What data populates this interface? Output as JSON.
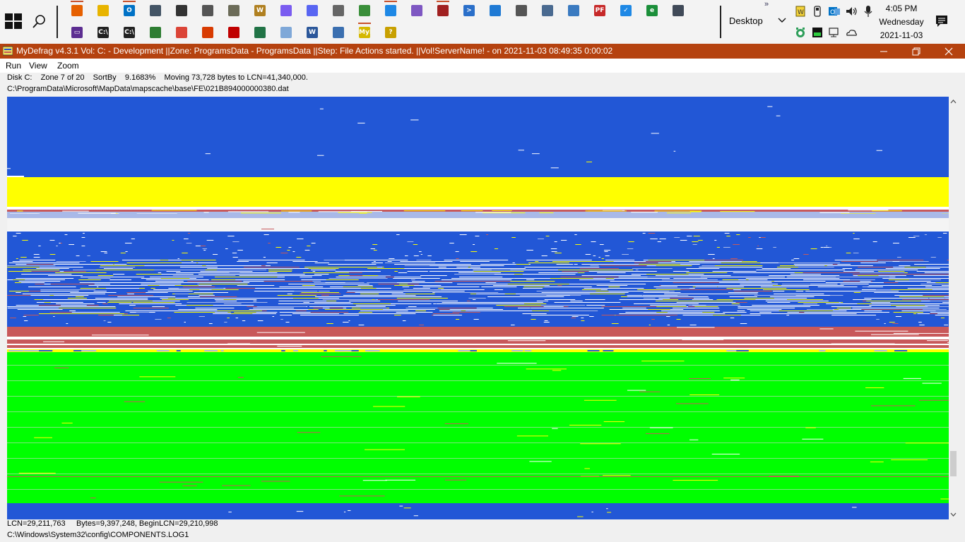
{
  "taskbar": {
    "pinned_row1": [
      {
        "name": "firefox-icon",
        "color": "#e66000",
        "glyph": "",
        "running": true
      },
      {
        "name": "file-explorer-icon",
        "color": "#e8b400",
        "glyph": "",
        "running": false
      },
      {
        "name": "outlook-icon",
        "color": "#0072c6",
        "glyph": "O",
        "running": true
      },
      {
        "name": "network-tool-icon",
        "color": "#445566",
        "glyph": "",
        "running": false
      },
      {
        "name": "camera-tool-icon",
        "color": "#333333",
        "glyph": "",
        "running": false
      },
      {
        "name": "robot-tool-icon",
        "color": "#555555",
        "glyph": "",
        "running": false
      },
      {
        "name": "gimp-icon",
        "color": "#6b6b58",
        "glyph": "",
        "running": false
      },
      {
        "name": "wordpad-icon",
        "color": "#b08020",
        "glyph": "W",
        "running": false
      },
      {
        "name": "messenger-icon",
        "color": "#7a5cf0",
        "glyph": "",
        "running": false
      },
      {
        "name": "discord-icon",
        "color": "#5865f2",
        "glyph": "",
        "running": false
      },
      {
        "name": "checklist-icon",
        "color": "#666666",
        "glyph": "",
        "running": false
      },
      {
        "name": "windows-xp-icon",
        "color": "#3a8f3a",
        "glyph": "",
        "running": false
      },
      {
        "name": "vscode-icon",
        "color": "#1e88e5",
        "glyph": "",
        "running": true
      },
      {
        "name": "visual-studio-icon",
        "color": "#7e57c2",
        "glyph": "",
        "running": false
      },
      {
        "name": "mydefrag-tool-icon",
        "color": "#a02020",
        "glyph": "",
        "running": true
      },
      {
        "name": "powershell-icon",
        "color": "#2a6fc9",
        "glyph": ">",
        "running": false
      },
      {
        "name": "calculator-grid-icon",
        "color": "#1f7ad4",
        "glyph": "",
        "running": false
      },
      {
        "name": "gear-icon",
        "color": "#555555",
        "glyph": "",
        "running": false
      },
      {
        "name": "computer-management-icon",
        "color": "#4a6a90",
        "glyph": "",
        "running": false
      },
      {
        "name": "control-panel-icon",
        "color": "#3a7ac0",
        "glyph": "",
        "running": false
      },
      {
        "name": "pdf-tool-icon",
        "color": "#c62828",
        "glyph": "PF",
        "running": false
      },
      {
        "name": "todo-check-icon",
        "color": "#1e88e5",
        "glyph": "✓",
        "running": false
      },
      {
        "name": "green-app-icon",
        "color": "#1b8f3a",
        "glyph": "e",
        "running": false
      },
      {
        "name": "remote-desktop-icon",
        "color": "#404a58",
        "glyph": "",
        "running": false
      }
    ],
    "pinned_row2": [
      {
        "name": "terminal-purple-icon",
        "color": "#5c2d91",
        "glyph": "▭",
        "running": false
      },
      {
        "name": "cmd-icon",
        "color": "#222222",
        "glyph": "C:\\",
        "running": false
      },
      {
        "name": "cmd-admin-icon",
        "color": "#222222",
        "glyph": "C:\\",
        "running": false
      },
      {
        "name": "palm-tree-icon",
        "color": "#2e7d32",
        "glyph": "",
        "running": false
      },
      {
        "name": "chrome-icon",
        "color": "#db4437",
        "glyph": "",
        "running": false
      },
      {
        "name": "office-icon",
        "color": "#d83b01",
        "glyph": "",
        "running": false
      },
      {
        "name": "acrobat-icon",
        "color": "#c00000",
        "glyph": "",
        "running": false
      },
      {
        "name": "excel-tool-icon",
        "color": "#217346",
        "glyph": "",
        "running": false
      },
      {
        "name": "notes-icon",
        "color": "#7fa8d8",
        "glyph": "",
        "running": false
      },
      {
        "name": "word-icon",
        "color": "#2b579a",
        "glyph": "W",
        "running": false
      },
      {
        "name": "document-icon",
        "color": "#3b6fb0",
        "glyph": "",
        "running": false
      },
      {
        "name": "mydefrag-icon",
        "color": "#d4b800",
        "glyph": "MyD",
        "running": true
      },
      {
        "name": "help-icon",
        "color": "#c8a000",
        "glyph": "?",
        "running": false
      }
    ],
    "desktop_label": "Desktop",
    "overflow": "»",
    "clock": {
      "time": "4:05 PM",
      "day": "Wednesday",
      "date": "2021-11-03"
    }
  },
  "window": {
    "title": "MyDefrag v4.3.1    Vol: C: - Development ||Zone: ProgramsData - ProgramsData ||Step: File Actions started. ||Vol!ServerName! -   on 2021-11-03 08:49:35 0:00:02",
    "titlebar_color": "#b5420f"
  },
  "menu": {
    "run": "Run",
    "view": "View",
    "zoom": "Zoom"
  },
  "status": {
    "line1": "Disk C:    Zone 7 of 20    SortBy    9.1683%    Moving 73,728 bytes to LCN=41,340,000.",
    "line2": "C:\\ProgramData\\Microsoft\\MapData\\mapscache\\base\\FE\\021B894000000380.dat",
    "bottom1": "LCN=29,211,763     Bytes=9,397,248, BeginLCN=29,210,998",
    "bottom2": "C:\\Windows\\System32\\config\\COMPONENTS.LOG1"
  },
  "diskmap_colors": {
    "blue": "#2257d6",
    "yellow": "#ffff00",
    "green": "#00ff00",
    "red": "#c8585a",
    "white": "#ffffff",
    "lightblue": "#a9b9e8",
    "gray": "#d0d0d0"
  }
}
